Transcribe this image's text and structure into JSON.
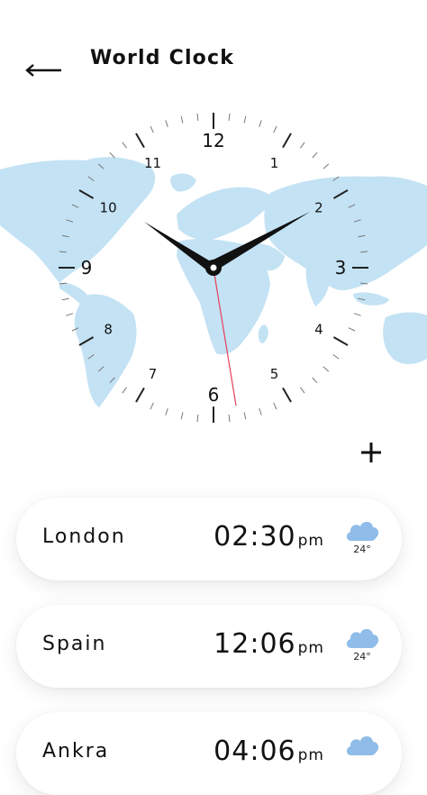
{
  "header": {
    "title": "World Clock",
    "back_icon": "arrow-left-icon"
  },
  "clock": {
    "numbers": [
      "12",
      "1",
      "2",
      "3",
      "4",
      "5",
      "6",
      "7",
      "8",
      "9",
      "10",
      "11"
    ],
    "hands": {
      "hour": 10,
      "minute": 10,
      "second": 32
    }
  },
  "add_icon": "plus-icon",
  "cities": [
    {
      "name": "London",
      "time": "02:30",
      "ampm": "pm",
      "temp": "24°",
      "icon": "cloud-icon"
    },
    {
      "name": "Spain",
      "time": "12:06",
      "ampm": "pm",
      "temp": "24°",
      "icon": "cloud-icon"
    },
    {
      "name": "Ankra",
      "time": "04:06",
      "ampm": "pm",
      "temp": "",
      "icon": "cloud-icon"
    }
  ],
  "colors": {
    "map": "#c3e2f4",
    "cloud": "#8fbce8",
    "second_hand": "#e4405a",
    "text": "#111111"
  }
}
